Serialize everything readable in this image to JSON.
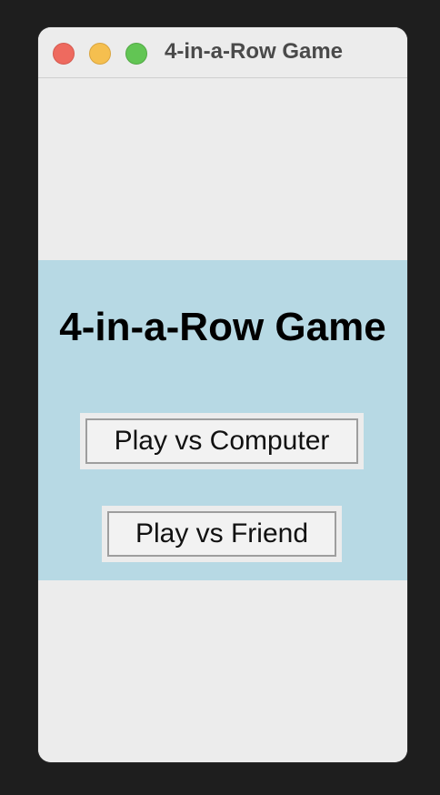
{
  "window": {
    "title": "4-in-a-Row Game"
  },
  "menu_screen": {
    "heading": "4-in-a-Row Game",
    "buttons": {
      "play_vs_computer": "Play vs Computer",
      "play_vs_friend": "Play vs Friend"
    }
  },
  "colors": {
    "panel_background": "#b7d9e4",
    "window_background": "#ececec",
    "close": "#ee6a5f",
    "minimize": "#f5bf4f",
    "maximize": "#62c554"
  }
}
